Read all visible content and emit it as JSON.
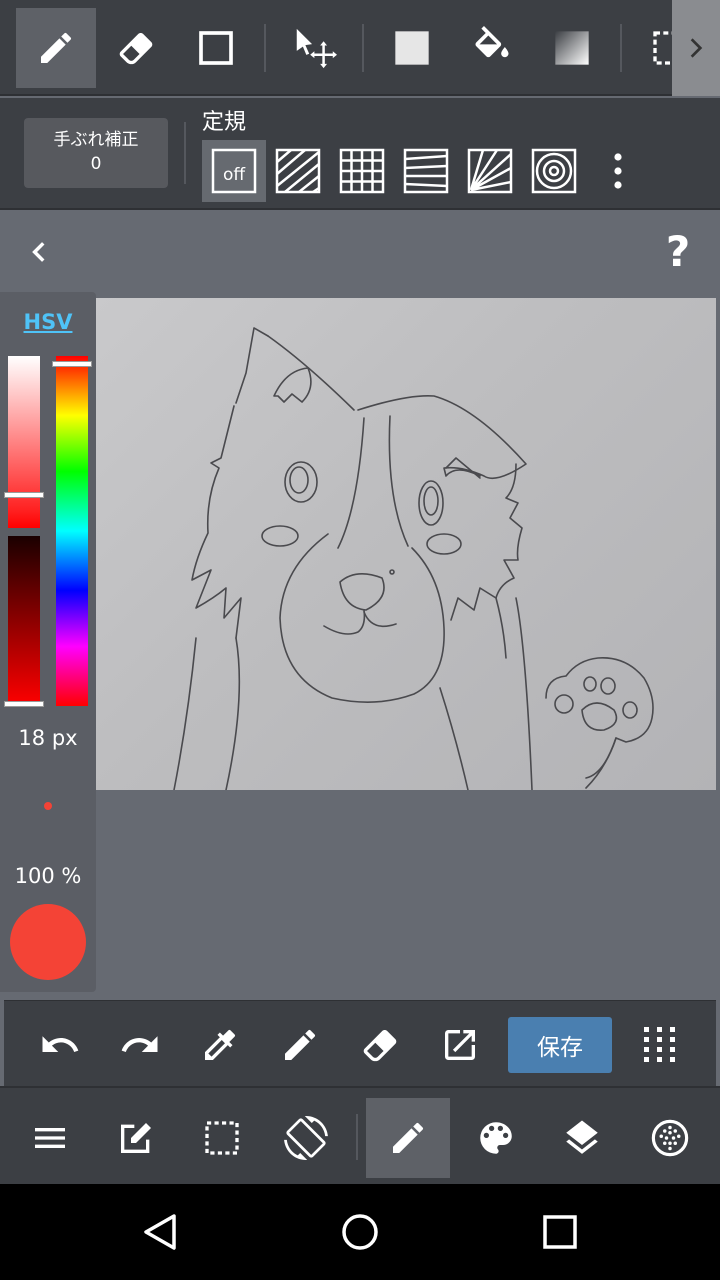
{
  "stabilizer": {
    "label": "手ぶれ補正",
    "value": "0"
  },
  "ruler": {
    "title": "定規",
    "off_label": "off"
  },
  "color_panel": {
    "mode_tab": "HSV",
    "brush_size": "18 px",
    "opacity": "100 %",
    "current_color": "#f44336"
  },
  "actions": {
    "save_label": "保存"
  },
  "colors": {
    "toolbar_bg": "#3c3f44",
    "active_bg": "#5e6167",
    "save_button": "#4a7fb0",
    "hsv_tab": "#4fc3f7"
  }
}
